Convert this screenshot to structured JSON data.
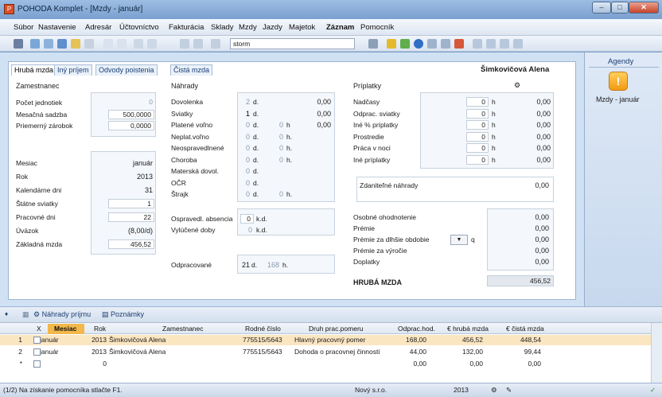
{
  "window": {
    "title": "POHODA Komplet - [Mzdy - január]",
    "icon": "pohoda-app-icon",
    "min": "–",
    "max": "□",
    "close": "✕"
  },
  "menu": [
    "Súbor",
    "Nastavenie",
    "Adresár",
    "Účtovníctvo",
    "Fakturácia",
    "Sklady",
    "Mzdy",
    "Jazdy",
    "Majetok",
    "Záznam",
    "Pomocník"
  ],
  "toolbar": {
    "search_value": "storm"
  },
  "tabs": [
    "Hrubá mzda",
    "Iný príjem",
    "Odvody poistenia",
    "Čistá mzda"
  ],
  "employee_name": "Šimkovičová Alena",
  "zamestnanec": {
    "title": "Zamestnanec",
    "rows": [
      {
        "label": "Počet jednotiek",
        "value": "0"
      },
      {
        "label": "Mesačná sadzba",
        "value": "500,0000"
      },
      {
        "label": "Priemerný zárobok",
        "value": "0,0000"
      }
    ],
    "rows2": [
      {
        "label": "Mesiac",
        "value": "január"
      },
      {
        "label": "Rok",
        "value": "2013"
      },
      {
        "label": "Kalendárne dni",
        "value": "31"
      },
      {
        "label": "Štátne sviatky",
        "value": "1"
      },
      {
        "label": "Pracovné dni",
        "value": "22"
      },
      {
        "label": "Úväzok",
        "value": "(8,00/d)"
      },
      {
        "label": "Základná mzda",
        "value": "456,52"
      }
    ]
  },
  "nahrady": {
    "title": "Náhrady",
    "rows": [
      {
        "label": "Dovolenka",
        "d": "2",
        "du": "d.",
        "h": "",
        "hu": "",
        "amt": "0,00"
      },
      {
        "label": "Sviatky",
        "d": "1",
        "du": "d.",
        "h": "",
        "hu": "",
        "amt": "0,00"
      },
      {
        "label": "Platené voľno",
        "d": "0",
        "du": "d.",
        "h": "0",
        "hu": "h",
        "amt": "0,00"
      },
      {
        "label": "Neplat.voľno",
        "d": "0",
        "du": "d.",
        "h": "0",
        "hu": "h.",
        "amt": ""
      },
      {
        "label": "Neospravedlnené",
        "d": "0",
        "du": "d.",
        "h": "0",
        "hu": "h.",
        "amt": ""
      },
      {
        "label": "Choroba",
        "d": "0",
        "du": "d.",
        "h": "0",
        "hu": "h.",
        "amt": ""
      },
      {
        "label": "Materská dovol.",
        "d": "0",
        "du": "d.",
        "h": "",
        "hu": "",
        "amt": ""
      },
      {
        "label": "OČR",
        "d": "0",
        "du": "d.",
        "h": "",
        "hu": "",
        "amt": ""
      },
      {
        "label": "Štrajk",
        "d": "0",
        "du": "d.",
        "h": "0",
        "hu": "h.",
        "amt": ""
      }
    ],
    "osprav_label": "Ospravedl. absencia",
    "osprav_val": "0",
    "osprav_unit": "k.d.",
    "vyluc_label": "Vylúčené doby",
    "vyluc_val": "0",
    "vyluc_unit": "k.d.",
    "odprac_label": "Odpracované",
    "odprac_d": "21",
    "odprac_du": "d.",
    "odprac_h": "168",
    "odprac_hu": "h."
  },
  "priplatky": {
    "title": "Príplatky",
    "rows": [
      {
        "label": "Nadčasy",
        "h": "0",
        "u": "h",
        "amt": "0,00"
      },
      {
        "label": "Odprac. sviatky",
        "h": "0",
        "u": "h",
        "amt": "0,00"
      },
      {
        "label": "Iné % príplatky",
        "h": "0",
        "u": "h",
        "amt": "0,00"
      },
      {
        "label": "Prostredie",
        "h": "0",
        "u": "h",
        "amt": "0,00"
      },
      {
        "label": "Práca v noci",
        "h": "0",
        "u": "h",
        "amt": "0,00"
      },
      {
        "label": "Iné príplatky",
        "h": "0",
        "u": "h",
        "amt": "0,00"
      }
    ],
    "zdanitelne_label": "Zdaniteľné náhrady",
    "zdanitelne_val": "0,00",
    "extra": [
      {
        "label": "Osobné ohodnotenie",
        "amt": "0,00"
      },
      {
        "label": "Prémie",
        "amt": "0,00"
      },
      {
        "label": "Prémie za dlhšie obdobie",
        "amt": "0,00"
      },
      {
        "label": "Prémie za výročie",
        "amt": "0,00"
      },
      {
        "label": "Doplatky",
        "amt": "0,00"
      }
    ],
    "q_label": "q",
    "hruba_label": "HRUBÁ MZDA",
    "hruba_val": "456,52"
  },
  "agendy": {
    "title": "Agendy",
    "item": "Mzdy - január"
  },
  "bottom_tabs": [
    "Náhrady príjmu",
    "Poznámky"
  ],
  "grid": {
    "headers": [
      "X",
      "Mesiac",
      "Rok",
      "Zamestnanec",
      "Rodné číslo",
      "Druh prac.pomeru",
      "Odprac.hod.",
      "€ hrubá mzda",
      "€ čistá mzda"
    ],
    "rows": [
      {
        "n": "1",
        "mes": "január",
        "rok": "2013",
        "zam": "Šimkovičová Alena",
        "rc": "775515/5643",
        "druh": "Hlavný pracovný pomer",
        "hod": "168,00",
        "hruba": "456,52",
        "cista": "448,54"
      },
      {
        "n": "2",
        "mes": "január",
        "rok": "2013",
        "zam": "Šimkovičová Alena",
        "rc": "775515/5643",
        "druh": "Dohoda o pracovnej činnosti",
        "hod": "44,00",
        "hruba": "132,00",
        "cista": "99,44"
      },
      {
        "n": "*",
        "mes": "",
        "rok": "0",
        "zam": "",
        "rc": "",
        "druh": "",
        "hod": "0,00",
        "hruba": "0,00",
        "cista": "0,00"
      }
    ]
  },
  "status": {
    "hint": "(1/2) Na získanie pomocníka stlačte F1.",
    "company": "Nový s.r.o.",
    "year": "2013"
  }
}
